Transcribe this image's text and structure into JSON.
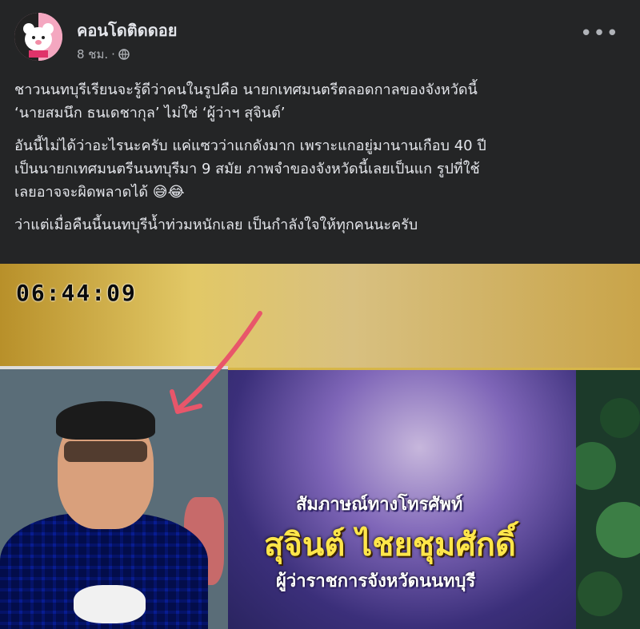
{
  "header": {
    "page_name": "คอนโดติดดอย",
    "time": "8 ชม.",
    "separator": "·",
    "privacy_icon": "globe-icon",
    "more_icon": "more-dots-icon"
  },
  "post": {
    "paragraphs": [
      "ชาวนนทบุรีเรียนจะรู้ดีว่าคนในรูปคือ นายกเทศมนตรีตลอดกาลของจังหวัดนี้\n‘นายสมนึก ธนเดชากุล’ ไม่ใช่ ‘ผู้ว่าฯ สุจินต์’",
      "อันนี้ไม่ได้ว่าอะไรนะครับ แค่แซวว่าแกดังมาก เพราะแกอยู่มานานเกือบ 40 ปี\nเป็นนายกเทศมนตรีนนทบุรีมา 9 สมัย ภาพจำของจังหวัดนี้เลยเป็นแก รูปที่ใช้\nเลยอาจจะผิดพลาดได้ 😅😂",
      "ว่าแต่เมื่อคืนนี้นนทบุรีน้ำท่วมหนักเลย เป็นกำลังใจให้ทุกคนนะครับ"
    ]
  },
  "photo": {
    "timestamp": "06:44:09",
    "caption_line1": "สัมภาษณ์ทางโทรศัพท์",
    "caption_line2": "สุจินต์ ไชยชุมศักดิ์",
    "caption_line3": "ผู้ว่าราชการจังหวัดนนทบุรี",
    "arrow_color": "#e8566a"
  },
  "colors": {
    "background": "#242526",
    "text": "#e4e6eb",
    "meta": "#b0b3b8"
  }
}
